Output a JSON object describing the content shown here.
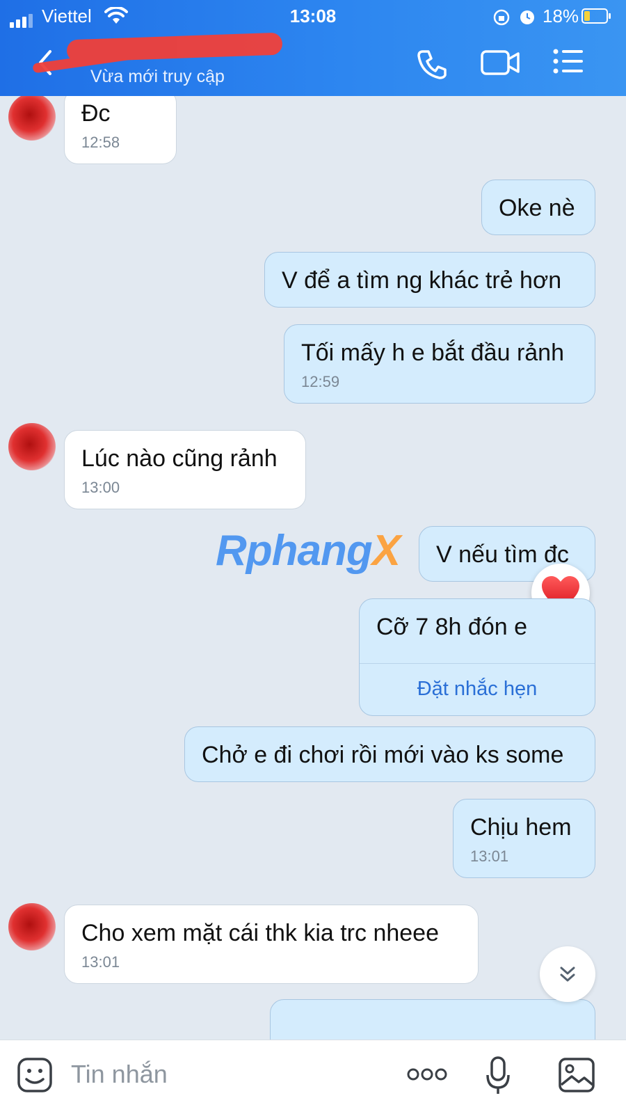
{
  "status_bar": {
    "carrier": "Viettel",
    "time": "13:08",
    "battery": "18%"
  },
  "header": {
    "subtitle": "Vừa mới truy cập"
  },
  "messages": [
    {
      "dir": "in",
      "text": "Đc",
      "time": "12:58"
    },
    {
      "dir": "out",
      "text": "Oke nè"
    },
    {
      "dir": "out",
      "text": "V để a tìm ng khác trẻ hơn"
    },
    {
      "dir": "out",
      "text": "Tối mấy h e bắt đầu rảnh",
      "time": "12:59"
    },
    {
      "dir": "in",
      "text": "Lúc nào cũng rảnh",
      "time": "13:00"
    },
    {
      "dir": "out",
      "text": "V nếu tìm đc"
    },
    {
      "dir": "out",
      "text": "Cỡ 7 8h đón e",
      "action": "Đặt nhắc hẹn"
    },
    {
      "dir": "out",
      "text": "Chở e đi chơi rồi mới vào ks some"
    },
    {
      "dir": "out",
      "text": "Chịu hem",
      "time": "13:01"
    },
    {
      "dir": "in",
      "text": "Cho xem mặt cái thk kia trc nheee",
      "time": "13:01"
    }
  ],
  "watermark": {
    "part1": "Rphang",
    "part2": "X"
  },
  "input": {
    "placeholder": "Tin nhắn"
  },
  "icons": [
    "back-icon",
    "phone-icon",
    "video-call-icon",
    "menu-icon",
    "heart-reaction-icon",
    "scroll-down-icon",
    "sticker-icon",
    "more-icon",
    "microphone-icon",
    "image-icon"
  ],
  "colors": {
    "header": "#2d86f0",
    "outgoing": "#d4ecfd",
    "incoming": "#ffffff",
    "background": "#e2e9f1",
    "link": "#2a6fd6"
  }
}
